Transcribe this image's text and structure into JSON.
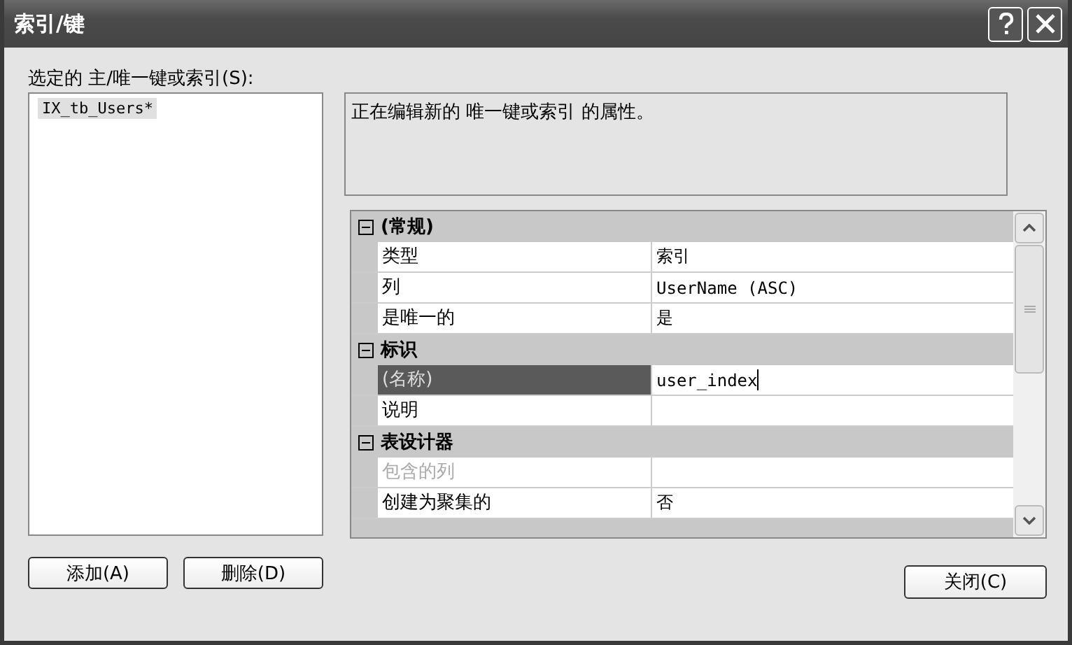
{
  "window": {
    "title": "索引/键"
  },
  "list": {
    "label": "选定的 主/唯一键或索引(S):",
    "items": [
      {
        "text": "IX_tb_Users*",
        "selected": true
      }
    ]
  },
  "description": "正在编辑新的 唯一键或索引 的属性。",
  "properties": [
    {
      "label": "(常规)",
      "expanded": true,
      "children": [
        {
          "label": "类型",
          "value": "索引",
          "selected": false,
          "disabled": false
        },
        {
          "label": "列",
          "value": "UserName (ASC)",
          "selected": false,
          "disabled": false
        },
        {
          "label": "是唯一的",
          "value": "是",
          "selected": false,
          "disabled": false
        }
      ]
    },
    {
      "label": "标识",
      "expanded": true,
      "children": [
        {
          "label": "(名称)",
          "value": "user_index",
          "selected": true,
          "disabled": false
        },
        {
          "label": "说明",
          "selected": false,
          "disabled": false
        }
      ]
    },
    {
      "label": "表设计器",
      "expanded": true,
      "children": [
        {
          "label": "包含的列",
          "selected": false,
          "disabled": true
        },
        {
          "label": "创建为聚集的",
          "value": "否",
          "selected": false,
          "disabled": false
        }
      ]
    }
  ],
  "list_buttons": [
    "添加(A)",
    "删除(D)"
  ],
  "close_button": "关闭(C)"
}
